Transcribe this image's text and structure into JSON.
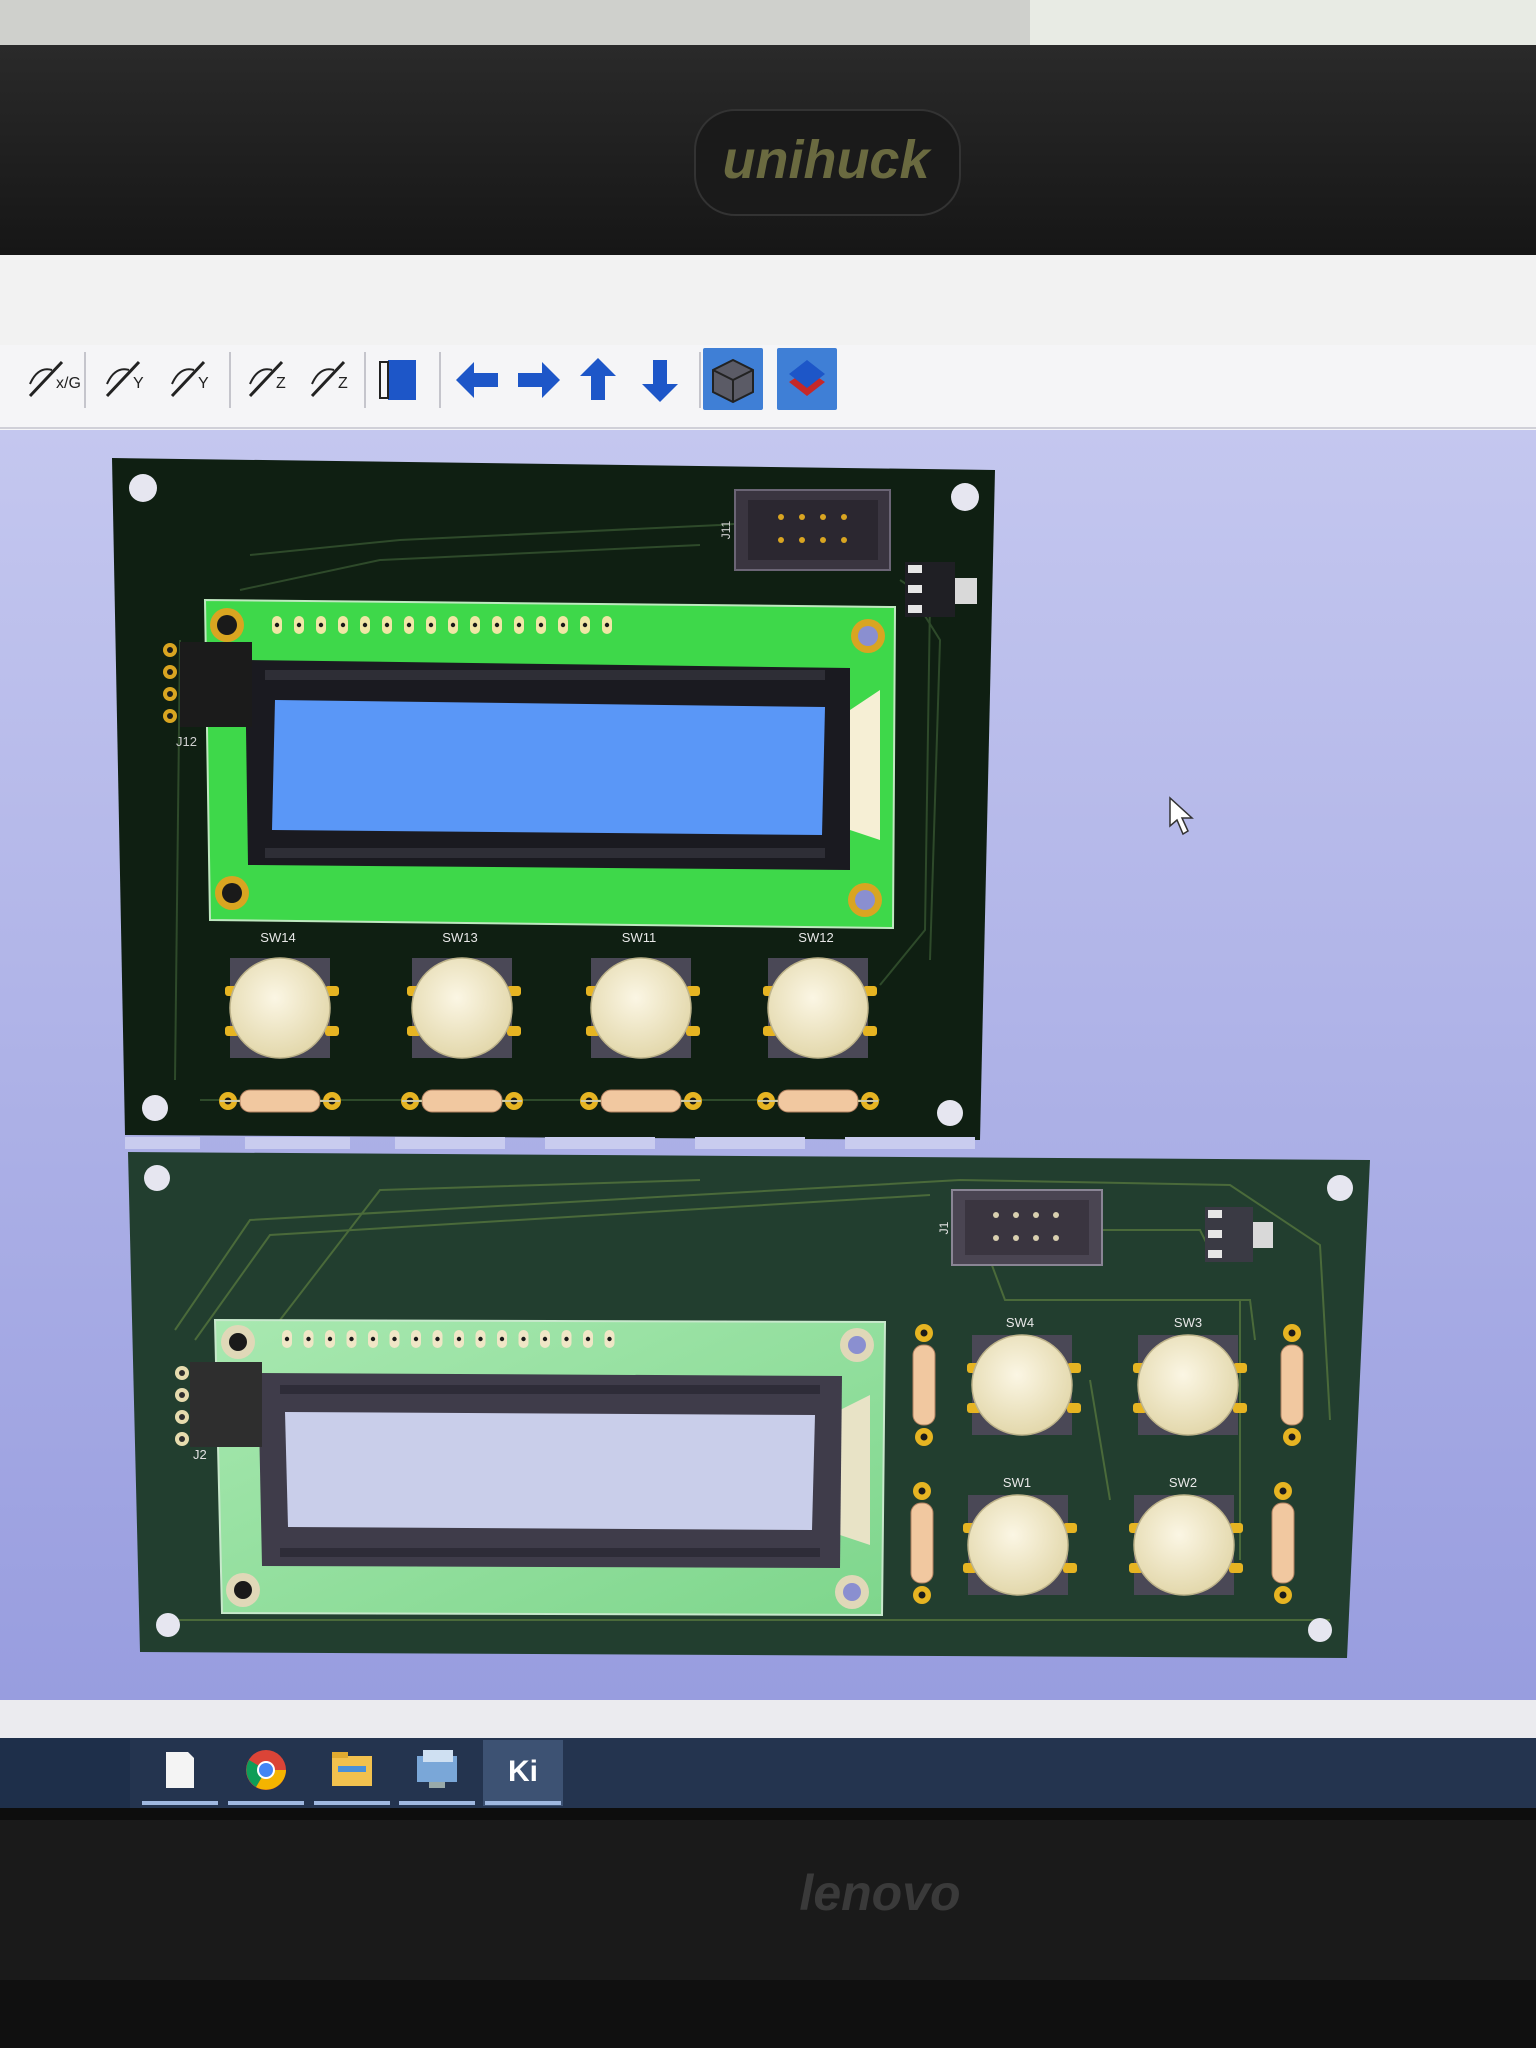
{
  "bezel": {
    "brand_top": "unihuck",
    "brand_bottom": "lenovo"
  },
  "toolbar": {
    "items": [
      {
        "name": "flip-x-icon",
        "glyph": "x/G"
      },
      {
        "name": "rotate-y-ccw-icon",
        "glyph": "Y"
      },
      {
        "name": "rotate-y-cw-icon",
        "glyph": "Y"
      },
      {
        "name": "rotate-z-ccw-icon",
        "glyph": "Z"
      },
      {
        "name": "rotate-z-cw-icon",
        "glyph": "Z"
      },
      {
        "name": "flip-board-icon"
      },
      {
        "name": "pan-left-icon"
      },
      {
        "name": "pan-right-icon"
      },
      {
        "name": "pan-up-icon"
      },
      {
        "name": "pan-down-icon"
      },
      {
        "name": "orthographic-icon"
      },
      {
        "name": "layers-icon"
      }
    ]
  },
  "board_top": {
    "header_ref": "J11",
    "lcd_connector_ref": "J12",
    "switches": [
      "SW14",
      "SW13",
      "SW11",
      "SW12"
    ]
  },
  "board_bottom": {
    "header_ref": "J1",
    "lcd_connector_ref": "J2",
    "switches_top_row": [
      "SW4",
      "SW3"
    ],
    "switches_bottom_row": [
      "SW1",
      "SW2"
    ]
  },
  "taskbar": {
    "items": [
      {
        "name": "notepad-icon"
      },
      {
        "name": "chrome-icon"
      },
      {
        "name": "file-explorer-icon"
      },
      {
        "name": "control-panel-icon"
      },
      {
        "name": "kicad-icon",
        "label": "Ki"
      }
    ]
  },
  "colors": {
    "viewport_top": "#c7c9f0",
    "viewport_bottom": "#9a9fe0",
    "board_top": "#102014",
    "board_bottom": "#1f3a2c",
    "lcd_green": "#3ed84a",
    "lcd_screen_blue": "#5a97f7",
    "lcd_screen_grey": "#c9ceea",
    "pad_gold": "#d9a521",
    "switch_cap": "#f1e8c6",
    "accent_arrow": "#1d56c8"
  }
}
